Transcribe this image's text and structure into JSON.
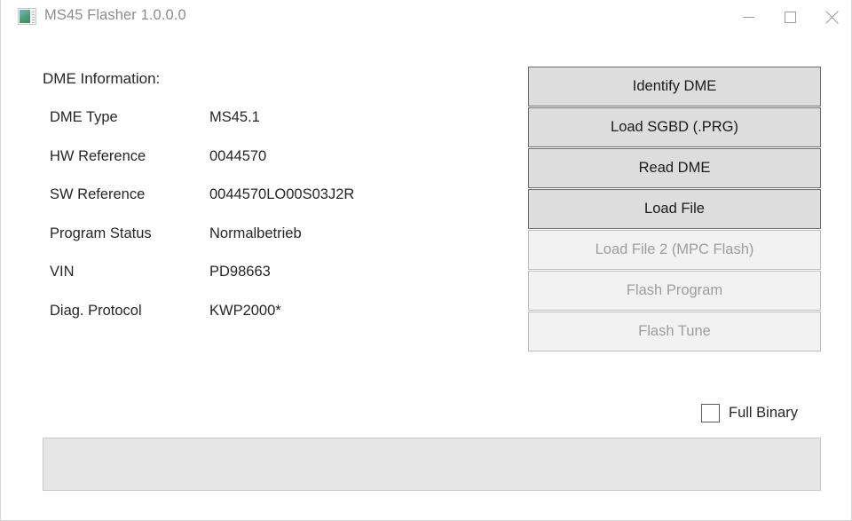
{
  "window": {
    "title": "MS45 Flasher 1.0.0.0",
    "icon": "app-window-icon",
    "controls": [
      {
        "name": "minimize",
        "glyph": "minimize-icon"
      },
      {
        "name": "maximize",
        "glyph": "maximize-icon"
      },
      {
        "name": "close",
        "glyph": "close-icon"
      }
    ]
  },
  "info": {
    "heading": "DME Information:",
    "rows": [
      {
        "label": "DME Type",
        "value": "MS45.1"
      },
      {
        "label": "HW Reference",
        "value": "0044570"
      },
      {
        "label": "SW Reference",
        "value": "0044570LO00S03J2R"
      },
      {
        "label": "Program Status",
        "value": "Normalbetrieb"
      },
      {
        "label": "VIN",
        "value": "PD98663"
      },
      {
        "label": "Diag. Protocol",
        "value": "KWP2000*"
      }
    ]
  },
  "actions": [
    {
      "label": "Identify DME",
      "enabled": true
    },
    {
      "label": "Load SGBD (.PRG)",
      "enabled": true
    },
    {
      "label": "Read DME",
      "enabled": true
    },
    {
      "label": "Load File",
      "enabled": true
    },
    {
      "label": "Load File 2 (MPC Flash)",
      "enabled": false
    },
    {
      "label": "Flash Program",
      "enabled": false
    },
    {
      "label": "Flash Tune",
      "enabled": false
    }
  ],
  "options": {
    "full_binary": {
      "label": "Full Binary",
      "checked": false
    }
  },
  "progress": {
    "value": 0,
    "text": ""
  },
  "colors": {
    "window_background": "#ffffff",
    "title_text": "#8d8d8d",
    "body_text": "#262626",
    "button_face": "#dddddd",
    "button_border": "#707070",
    "button_disabled_face": "#f2f2f2",
    "button_disabled_border": "#bfbfbf",
    "button_disabled_text": "#9d9d9d",
    "progress_face": "#e6e6e6",
    "progress_border": "#c8c8c8"
  }
}
